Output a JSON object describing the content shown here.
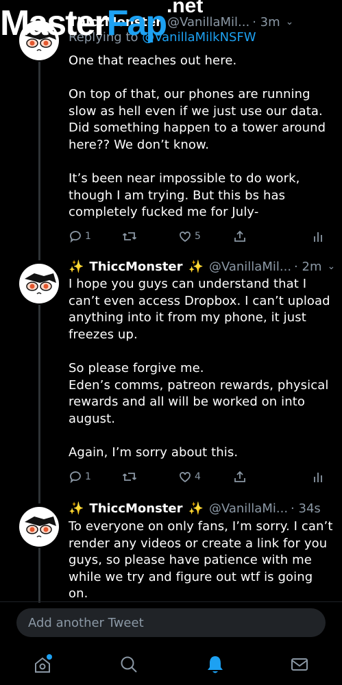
{
  "watermark": {
    "part1": "Master",
    "part2": "Fap",
    "part3": ".net"
  },
  "tweets": [
    {
      "name": "ThiccMonster",
      "handle": "@VanillaMil...",
      "time": "· 3m",
      "replying_prefix": "Replying to",
      "replying_handle": "@VanillaMilkNSFW",
      "text": "One that reaches out here.\n\nOn top of that, our phones are running slow as hell even if we just use our data. Did something happen to a tower around here?? We don’t know.\n\nIt’s been near impossible to do work, though I am trying. But this bs has completely fucked me for July-",
      "reply_count": "1",
      "retweet_count": "",
      "like_count": "5"
    },
    {
      "name_prefix": "✨",
      "name": "ThiccMonster",
      "name_suffix": "✨",
      "handle": "@VanillaMil...",
      "time": "· 2m",
      "text": "I hope you guys can understand that I can’t even access Dropbox. I can’t upload anything into it from my phone, it just freezes up.\n\nSo please forgive me.\nEden’s comms, patreon rewards, physical rewards and all will be worked on into august.\n\nAgain, I’m sorry about this.",
      "reply_count": "1",
      "retweet_count": "",
      "like_count": "4"
    },
    {
      "name_prefix": "✨",
      "name": "ThiccMonster",
      "name_suffix": "✨",
      "handle": "@VanillaMi...",
      "time": "· 34s",
      "text": "To everyone on only fans, I’m sorry. I can’t render any videos or create a link for you guys, so please have patience with me while we try and figure out wtf is going on."
    }
  ],
  "compose": {
    "placeholder": "Add another Tweet"
  },
  "tabs": [
    {
      "icon": "home-icon"
    },
    {
      "icon": "search-icon"
    },
    {
      "icon": "bell-icon",
      "active": true
    },
    {
      "icon": "mail-icon"
    }
  ],
  "colors": {
    "accent": "#1da1f2",
    "muted": "#8b98a5",
    "background": "#000000"
  }
}
